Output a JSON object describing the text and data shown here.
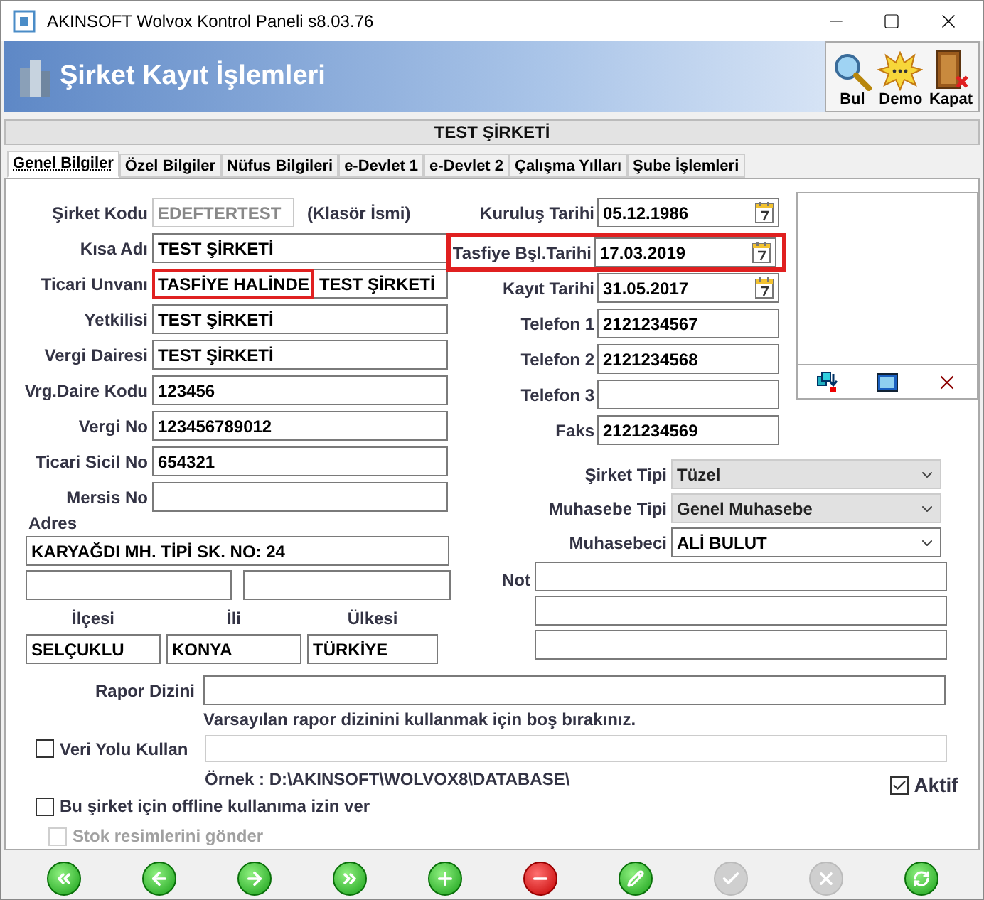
{
  "window": {
    "title": "AKINSOFT Wolvox Kontrol Paneli s8.03.76"
  },
  "header": {
    "title": "Şirket Kayıt İşlemleri",
    "tools": [
      {
        "label": "Bul",
        "kind": "search"
      },
      {
        "label": "Demo",
        "kind": "demo"
      },
      {
        "label": "Kapat",
        "kind": "exit"
      }
    ]
  },
  "company_bar": "TEST ŞİRKETİ",
  "tabs": [
    {
      "label": "Genel Bilgiler",
      "selected": true
    },
    {
      "label": "Özel Bilgiler",
      "selected": false
    },
    {
      "label": "Nüfus Bilgileri",
      "selected": false
    },
    {
      "label": "e-Devlet 1",
      "selected": false
    },
    {
      "label": "e-Devlet 2",
      "selected": false
    },
    {
      "label": "Çalışma Yılları",
      "selected": false
    },
    {
      "label": "Şube İşlemleri",
      "selected": false
    }
  ],
  "left_fields": [
    {
      "label": "Şirket Kodu",
      "value": "EDEFTERTEST",
      "readonly": true,
      "note": "(Klasör İsmi)"
    },
    {
      "label": "Kısa Adı",
      "value": "TEST ŞİRKETİ"
    },
    {
      "label": "Ticari Unvanı",
      "highlighted_value": "TASFİYE HALİNDE",
      "value": "TEST ŞİRKETİ"
    },
    {
      "label": "Yetkilisi",
      "value": "TEST ŞİRKETİ"
    },
    {
      "label": "Vergi Dairesi",
      "value": "TEST ŞİRKETİ"
    },
    {
      "label": "Vrg.Daire Kodu",
      "value": "123456"
    },
    {
      "label": "Vergi No",
      "value": "123456789012"
    },
    {
      "label": "Ticari Sicil No",
      "value": "654321"
    },
    {
      "label": "Mersis No"
    }
  ],
  "right_fields": [
    {
      "label": "Kuruluş Tarihi",
      "value": "05.12.1986",
      "kind": "date",
      "highlighted": false
    },
    {
      "label": "Tasfiye Bşl.Tarihi",
      "value": "17.03.2019",
      "kind": "date",
      "highlighted": true
    },
    {
      "label": "Kayıt Tarihi",
      "value": "31.05.2017",
      "kind": "date",
      "highlighted": false
    },
    {
      "label": "Telefon 1",
      "value": "2121234567",
      "kind": "text",
      "highlighted": false
    },
    {
      "label": "Telefon 2",
      "value": "2121234568",
      "kind": "text",
      "highlighted": false
    },
    {
      "label": "Telefon 3",
      "kind": "text",
      "highlighted": false
    },
    {
      "label": "Faks",
      "value": "2121234569",
      "kind": "text",
      "highlighted": false
    }
  ],
  "combos": [
    {
      "label": "Şirket Tipi",
      "value": "Tüzel",
      "disabled": true
    },
    {
      "label": "Muhasebe Tipi",
      "value": "Genel Muhasebe",
      "disabled": true
    },
    {
      "label": "Muhasebeci",
      "value": "ALİ BULUT",
      "disabled": false
    }
  ],
  "address": {
    "label": "Adres",
    "line1": "KARYAĞDI MH. TİPİ SK. NO: 24",
    "places": [
      {
        "label": "İlçesi",
        "value": "SELÇUKLU"
      },
      {
        "label": "İli",
        "value": "KONYA"
      },
      {
        "label": "Ülkesi",
        "value": "TÜRKİYE"
      }
    ]
  },
  "note_label": "Not",
  "report": {
    "label": "Rapor Dizini",
    "hint": "Varsayılan rapor dizinini kullanmak için boş bırakınız."
  },
  "data_path": {
    "label": "Veri Yolu Kullan",
    "checked": false,
    "example": "Örnek : D:\\AKINSOFT\\WOLVOX8\\DATABASE\\"
  },
  "active": {
    "label": "Aktif",
    "checked": true
  },
  "offline": {
    "label": "Bu şirket için offline kullanıma izin ver",
    "checked": false
  },
  "send_images": {
    "label": "Stok resimlerini gönder",
    "checked": false,
    "disabled": true
  },
  "nav_buttons": [
    {
      "kind": "first",
      "disabled": false
    },
    {
      "kind": "prev",
      "disabled": false
    },
    {
      "kind": "next",
      "disabled": false
    },
    {
      "kind": "last",
      "disabled": false
    },
    {
      "kind": "add",
      "disabled": false
    },
    {
      "kind": "delete",
      "disabled": false
    },
    {
      "kind": "edit",
      "disabled": false
    },
    {
      "kind": "save",
      "disabled": true
    },
    {
      "kind": "cancel",
      "disabled": true
    },
    {
      "kind": "refresh",
      "disabled": false
    }
  ]
}
